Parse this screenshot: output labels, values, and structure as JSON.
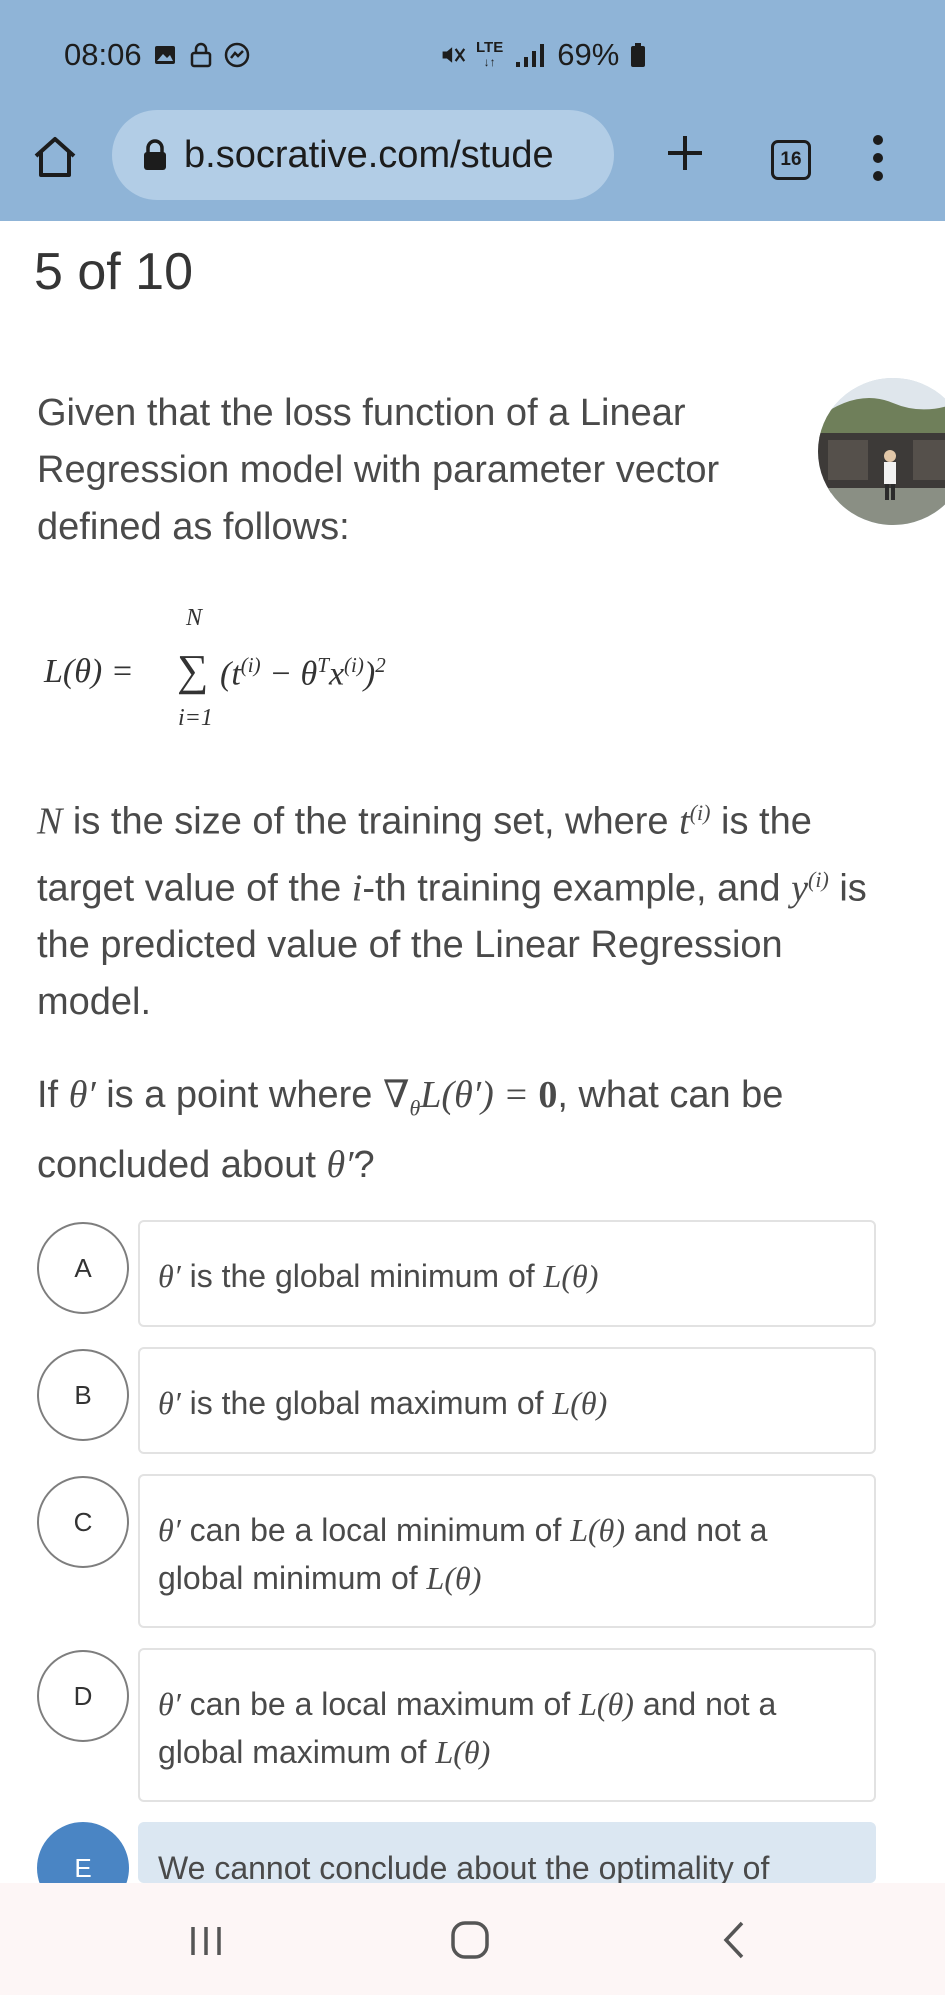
{
  "status_bar": {
    "time": "08:06",
    "left_icons": [
      "image-icon",
      "lock-icon",
      "messenger-icon"
    ],
    "right_icons": [
      "mute-icon",
      "lte-icon",
      "signal-icon",
      "battery-icon"
    ],
    "network": "LTE",
    "battery": "69%"
  },
  "browser": {
    "url": "b.socrative.com/stude",
    "tab_count": "16"
  },
  "question": {
    "progress": "5 of 10",
    "intro": "Given that the loss function of a Linear Regression model with parameter vector defined as follows:",
    "formula": {
      "lhs": "L(θ) =",
      "upper": "N",
      "sigma": "∑",
      "body": "(t",
      "sup_i": "(i)",
      "minus": " − θ",
      "sup_T": "T",
      "x": "x",
      "close": ")",
      "sq": "2",
      "lower": "i=1"
    },
    "para2": {
      "N": "N",
      "a": " is the size of the training set, where ",
      "t": "t",
      "sup": "(i)",
      "b": " is the target value of the ",
      "i": "i",
      "c": "-th training example, and ",
      "y": "y",
      "d": " is the predicted value of the Linear Regression model."
    },
    "para3": {
      "a": "If ",
      "theta": "θ′",
      "b": " is a point where ",
      "grad": "∇",
      "sub": "θ",
      "expr": "L(θ′) = ",
      "zero": "0",
      "c": ", what can be concluded about ",
      "d": "?"
    }
  },
  "options": [
    {
      "letter": "A",
      "theta": "θ′",
      "text": " is the global minimum of ",
      "L1": "L(θ)",
      "mid": "",
      "L2": "",
      "end": "",
      "selected": false
    },
    {
      "letter": "B",
      "theta": "θ′",
      "text": " is the global maximum of ",
      "L1": "L(θ)",
      "mid": "",
      "L2": "",
      "end": "",
      "selected": false
    },
    {
      "letter": "C",
      "theta": "θ′",
      "text": " can be a local minimum of ",
      "L1": "L(θ)",
      "mid": " and not a global minimum of ",
      "L2": "L(θ)",
      "end": "",
      "selected": false
    },
    {
      "letter": "D",
      "theta": "θ′",
      "text": " can be a local maximum of ",
      "L1": "L(θ)",
      "mid": " and not a global maximum of ",
      "L2": "L(θ)",
      "end": "",
      "selected": false
    },
    {
      "letter": "E",
      "theta": "",
      "text": "We cannot conclude about the optimality of",
      "L1": "",
      "mid": "",
      "L2": "",
      "end": "",
      "selected": true
    }
  ],
  "colors": {
    "topbar": "#8fb4d7",
    "urlbar": "#b2cde6",
    "selected_circle": "#4a85c4",
    "selected_box": "#dbe7f2"
  }
}
